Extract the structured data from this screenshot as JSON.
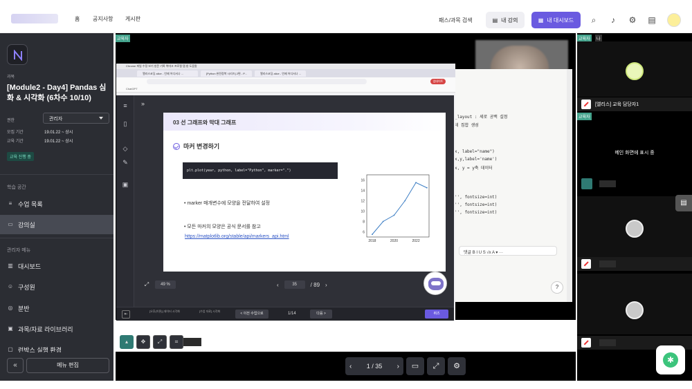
{
  "topbar": {
    "nav": [
      "홈",
      "공지사항",
      "게시판"
    ],
    "search_course": "패스/과목 검색",
    "my_course": "내 강의",
    "my_dashboard": "내 대시보드"
  },
  "sidebar": {
    "caption": "과목",
    "course_title": "[Module2 - Day4] Pandas 심화 & 시각화 (6차수 10/10)",
    "role_label": "권한",
    "role_value": "관리자",
    "recruit_label": "모집 기간",
    "recruit_value": "19.01.22 ~ 상시",
    "edu_label": "교육 기간",
    "edu_value": "19.01.22 ~ 상시",
    "status_badge": "교육 진행 중",
    "section_learning": "학습 공간",
    "items_learning": [
      "수업 목록",
      "강의실"
    ],
    "section_admin": "관리자 메뉴",
    "items_admin": [
      "대시보드",
      "구성원",
      "분반",
      "과목/자료 라이브러리",
      "런박스 실행 환경"
    ],
    "collapse": "«",
    "menu_edit": "메뉴 편집"
  },
  "main": {
    "tag": "교육자",
    "browser": {
      "menubar": "Chrome   파일   수정   보기   방문 기록   북마크   프로필   탭   창   도움말",
      "tabs": [
        "엘리스코딩 alice - 언제 어디서나 ...",
        "[Python 완전정복 시리즈] 2편 - P...",
        "엘리스코딩 alice - 언제 어디서나 ..."
      ],
      "update": "업데이트",
      "bookmark": "ChatGPT"
    },
    "slide": {
      "header": "03 선 그래프와 막대 그래프",
      "subtitle": "마커 변경하기",
      "code": "plt.plot(year, python, label=\"Python\", marker=\".\")",
      "bullet1": "• marker 매개변수에 모양을 전달하여 설정",
      "bullet2": "• 모든 마커의 모양은 공식 문서를 참고",
      "link": "https://matplotlib.org/stable/api/markers_api.html"
    },
    "viewer": {
      "zoom": "49 %",
      "page": "35",
      "total": "/ 89",
      "crumb1": "[오후(이론)] 데이터 시각화",
      "crumb2": "[수업 자료] 시각화",
      "prev_class": "< 이전 수업으로",
      "page_count": "1/14",
      "next": "다음 >",
      "quiz": "퀴즈"
    },
    "editor_lines": [
      "_layout : 세로 공백 설정",
      "테 집합 생성",
      "",
      "x, label=\"name\")",
      "x,y,label='name')",
      "x, y = y축 데이터",
      "",
      "",
      "",
      "",
      "'', fontsize=int)",
      "'', fontsize=int)",
      "'', fontsize=int)"
    ],
    "editor_toolbar": "댓글   B  I  U  S  √x   A ▾  ···",
    "help": "?",
    "pager": "1 / 35"
  },
  "right_panel": {
    "tag_edu": "교육자",
    "tag_me": "나",
    "tile1_name": "[엘리스] 교육 담당자1",
    "main_screen": "메인 화면에 표시 중"
  },
  "chart_data": {
    "type": "line",
    "x": [
      2017,
      2018,
      2019,
      2020,
      2021,
      2022,
      2023
    ],
    "values": [
      5.5,
      8.0,
      9.2,
      12.0,
      15.5,
      14.5
    ],
    "categories": [
      "2018",
      "2020",
      "2022"
    ],
    "yticks": [
      "6",
      "8",
      "10",
      "12",
      "14",
      "16"
    ]
  }
}
